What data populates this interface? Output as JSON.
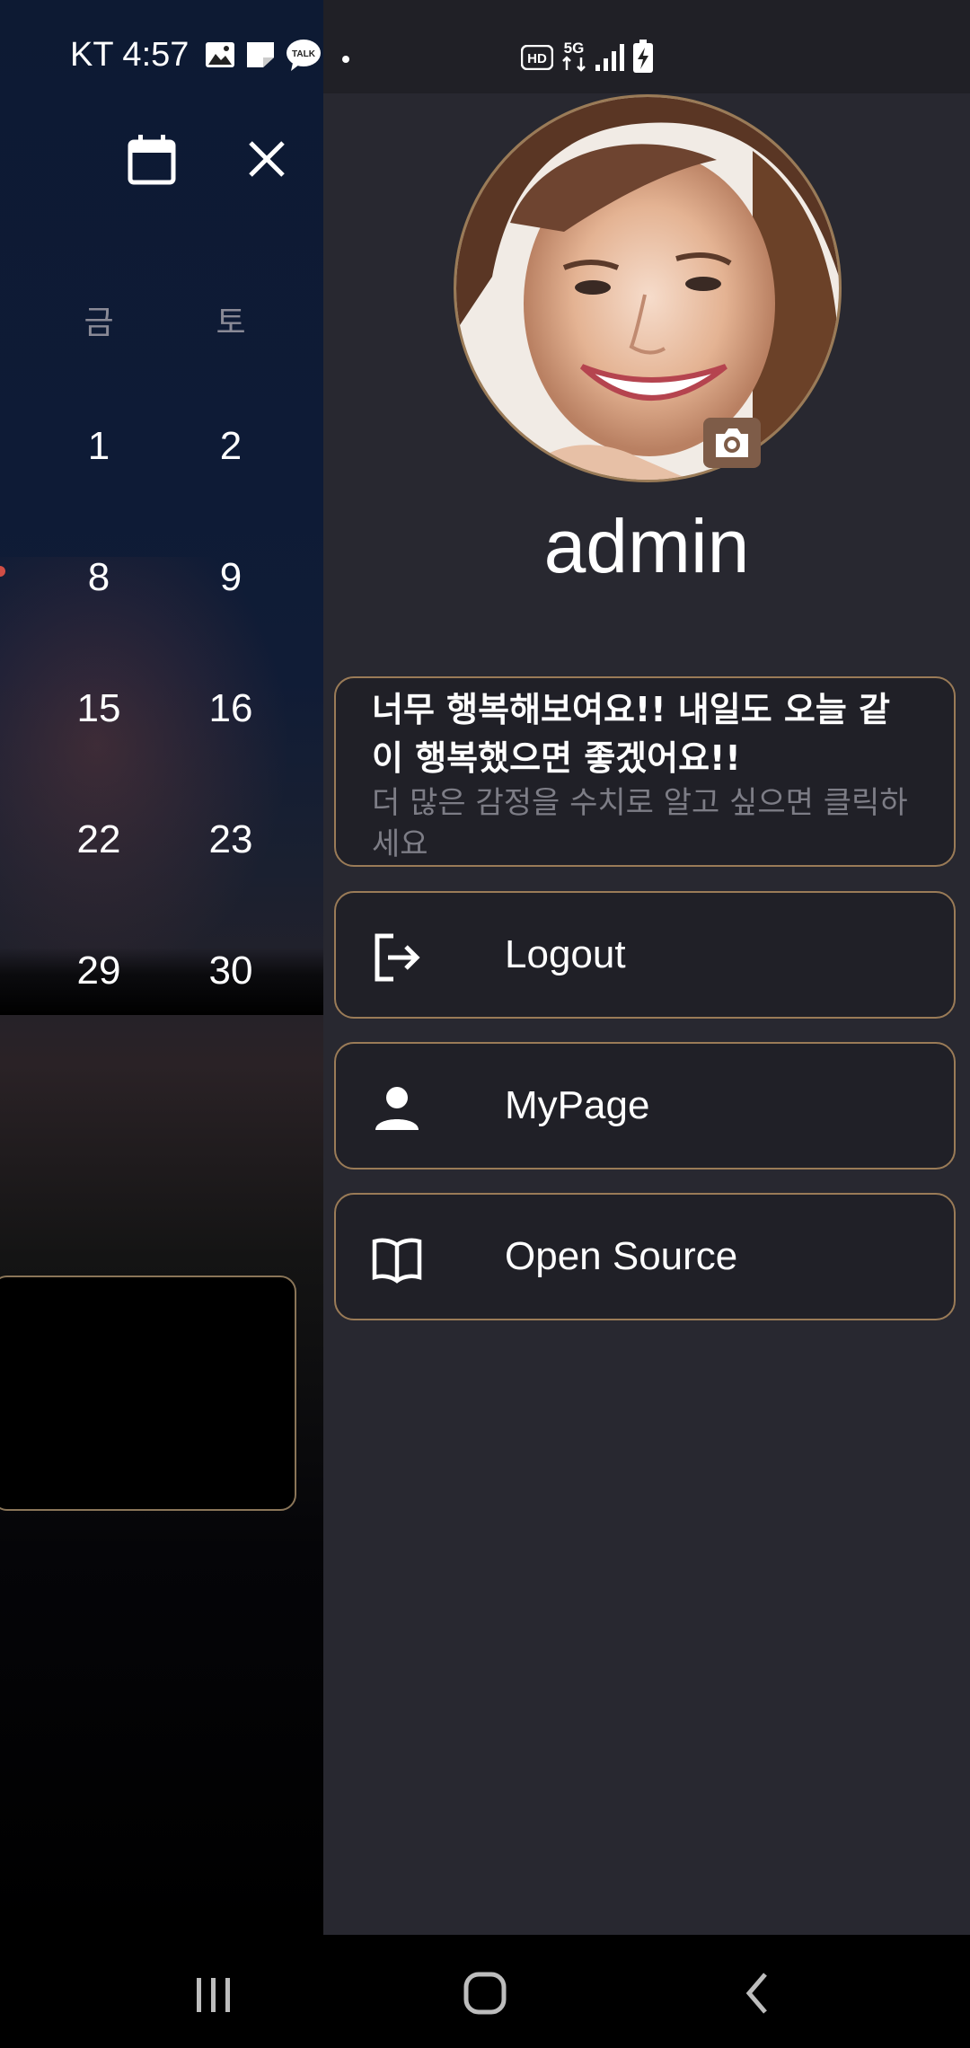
{
  "status_bar": {
    "carrier_time": "KT 4:57",
    "indicators": [
      "gallery-icon",
      "memo-icon",
      "kakaotalk-icon",
      "dot-icon"
    ],
    "network": [
      "hd-icon",
      "5g-icon",
      "signal-icon",
      "battery-charging-icon"
    ],
    "kakao_text": "TALK",
    "hd_text": "HD",
    "fiveg_text": "5G"
  },
  "calendar": {
    "weekday_headers": [
      "금",
      "토"
    ],
    "rows": [
      [
        "1",
        "2"
      ],
      [
        "8",
        "9"
      ],
      [
        "15",
        "16"
      ],
      [
        "22",
        "23"
      ],
      [
        "29",
        "30"
      ]
    ]
  },
  "drawer": {
    "username": "admin",
    "mood": {
      "title": "너무 행복해보여요!! 내일도 오늘 같이 행복했으면 좋겠어요!!",
      "subtitle": "더 많은 감정을 수치로 알고 싶으면 클릭하세요"
    },
    "menu": [
      {
        "label": "Logout",
        "icon": "logout-icon"
      },
      {
        "label": "MyPage",
        "icon": "person-icon"
      },
      {
        "label": "Open Source",
        "icon": "book-icon"
      }
    ]
  },
  "colors": {
    "drawer_bg": "#282830",
    "card_border": "#9a7b57",
    "text": "#ffffff",
    "muted": "#7d7d86"
  }
}
